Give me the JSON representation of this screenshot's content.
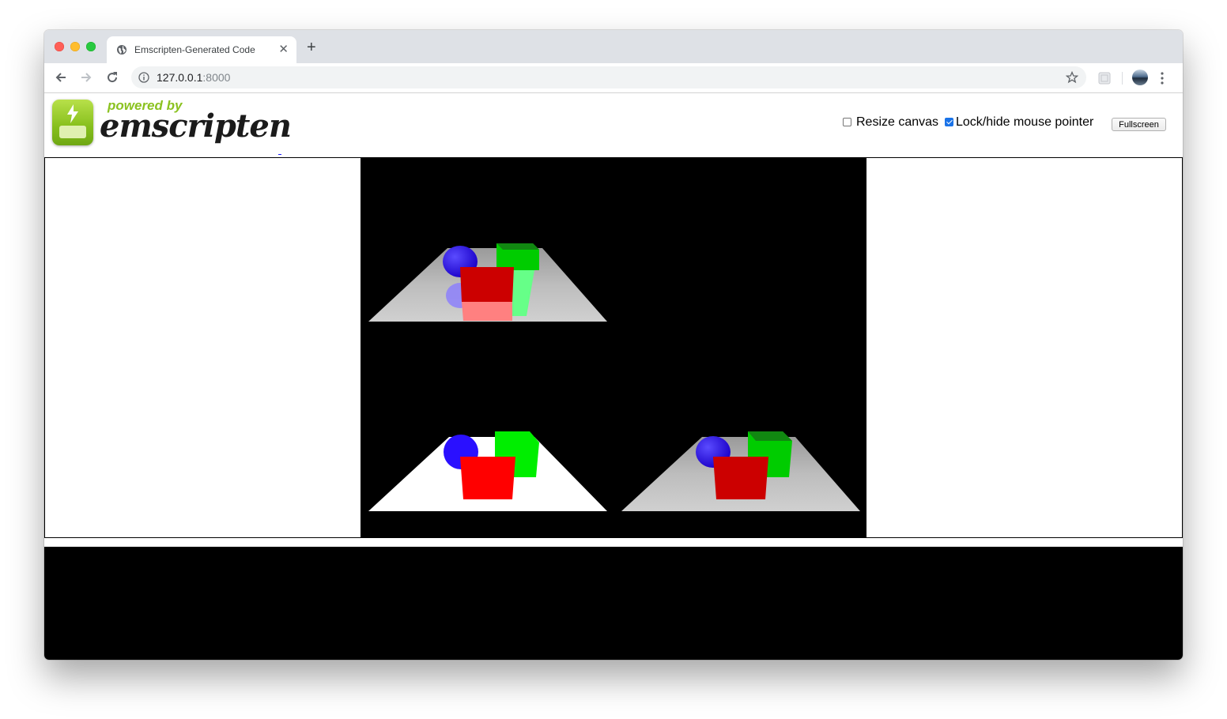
{
  "browser": {
    "tab": {
      "title": "Emscripten-Generated Code",
      "close_glyph": "✕"
    },
    "new_tab_glyph": "+",
    "address": {
      "host": "127.0.0.1",
      "port": ":8000"
    }
  },
  "page": {
    "logo": {
      "tagline": "powered by",
      "name": "emscripten"
    },
    "controls": {
      "resize_canvas": {
        "label": "Resize canvas",
        "checked": false
      },
      "lock_pointer": {
        "label": "Lock/hide mouse pointer",
        "checked": true
      },
      "fullscreen_label": "Fullscreen"
    },
    "canvas": {
      "viewports": [
        {
          "view": "top-left",
          "floor_color": "#b0b0b0",
          "reflections": true
        },
        {
          "view": "bottom-left",
          "floor_color": "#ffffff",
          "reflections": false
        },
        {
          "view": "bottom-right",
          "floor_color": "#b0b0b0",
          "reflections": false
        }
      ],
      "objects": {
        "sphere_color": "#2a10ff",
        "front_cube_color": "#ff0000",
        "back_cube_color": "#00ee00"
      }
    },
    "output_console": ""
  }
}
